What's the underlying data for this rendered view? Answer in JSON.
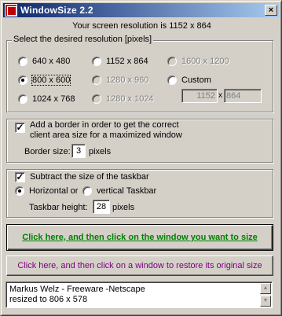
{
  "window": {
    "title": "WindowSize 2.2",
    "close_glyph": "×"
  },
  "info": {
    "screen_resolution_text": "Your screen resolution is 1152 x 864"
  },
  "resolution_group": {
    "label": "Select the desired resolution [pixels]",
    "options": [
      {
        "label": "640 x 480",
        "selected": false,
        "enabled": true
      },
      {
        "label": "1152 x 864",
        "selected": false,
        "enabled": true
      },
      {
        "label": "1600 x 1200",
        "selected": false,
        "enabled": false
      },
      {
        "label": "800 x 600",
        "selected": true,
        "enabled": true
      },
      {
        "label": "1280 x 960",
        "selected": false,
        "enabled": false
      },
      {
        "label": "Custom",
        "selected": false,
        "enabled": true
      },
      {
        "label": "1024 x 768",
        "selected": false,
        "enabled": true
      },
      {
        "label": "1280 x 1024",
        "selected": false,
        "enabled": false
      }
    ],
    "custom_width": "1152",
    "custom_x": "x",
    "custom_height": "864"
  },
  "border_group": {
    "checkbox_checked": true,
    "check_mark": "✓",
    "label_line1": "Add a border in order to get the correct",
    "label_line2": "client area size for a maximized window",
    "border_size_label": "Border size:",
    "border_size_value": "3",
    "pixels_unit": "pixels"
  },
  "taskbar_group": {
    "checkbox_checked": true,
    "check_mark": "✓",
    "label": "Subtract the size of the taskbar",
    "horizontal_label": "Horizontal or",
    "vertical_label": "vertical Taskbar",
    "horizontal_selected": true,
    "height_label": "Taskbar height:",
    "height_value": "28",
    "pixels_unit": "pixels"
  },
  "buttons": {
    "resize_label": "Click here, and then click on the window you want to size",
    "restore_label": "Click here, and then click on a window to restore its original size"
  },
  "log": {
    "line1": "Markus Welz - Freeware -Netscape",
    "line2": "resized to 806 x 578"
  },
  "colors": {
    "title_gradient_start": "#0a246a",
    "title_gradient_end": "#a6caf0",
    "face": "#d4d0c8",
    "resize_button_text": "#008000",
    "restore_button_text": "#800080"
  },
  "icons": [
    "app-icon",
    "close-icon",
    "scroll-up-icon",
    "scroll-down-icon"
  ]
}
